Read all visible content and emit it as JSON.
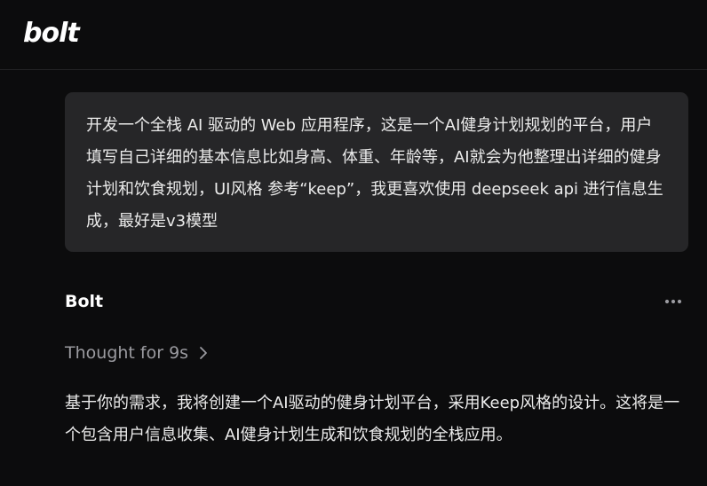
{
  "header": {
    "logo_text": "bolt"
  },
  "conversation": {
    "user_message": "开发一个全栈 AI 驱动的 Web 应用程序，这是一个AI健身计划规划的平台，用户填写自己详细的基本信息比如身高、体重、年龄等，AI就会为他整理出详细的健身计划和饮食规划，UI风格 参考“keep”，我更喜欢使用 deepseek api 进行信息生成，最好是v3模型",
    "assistant": {
      "name": "Bolt",
      "more_icon": "ellipsis-icon",
      "thought_label": "Thought for 9s",
      "thought_icon": "chevron-right-icon",
      "message": "基于你的需求，我将创建一个AI驱动的健身计划平台，采用Keep风格的设计。这将是一个包含用户信息收集、AI健身计划生成和饮食规划的全栈应用。"
    }
  },
  "colors": {
    "background": "#0c0c0d",
    "bubble": "#262628",
    "text": "#ececec",
    "muted": "#9b9ba0"
  }
}
